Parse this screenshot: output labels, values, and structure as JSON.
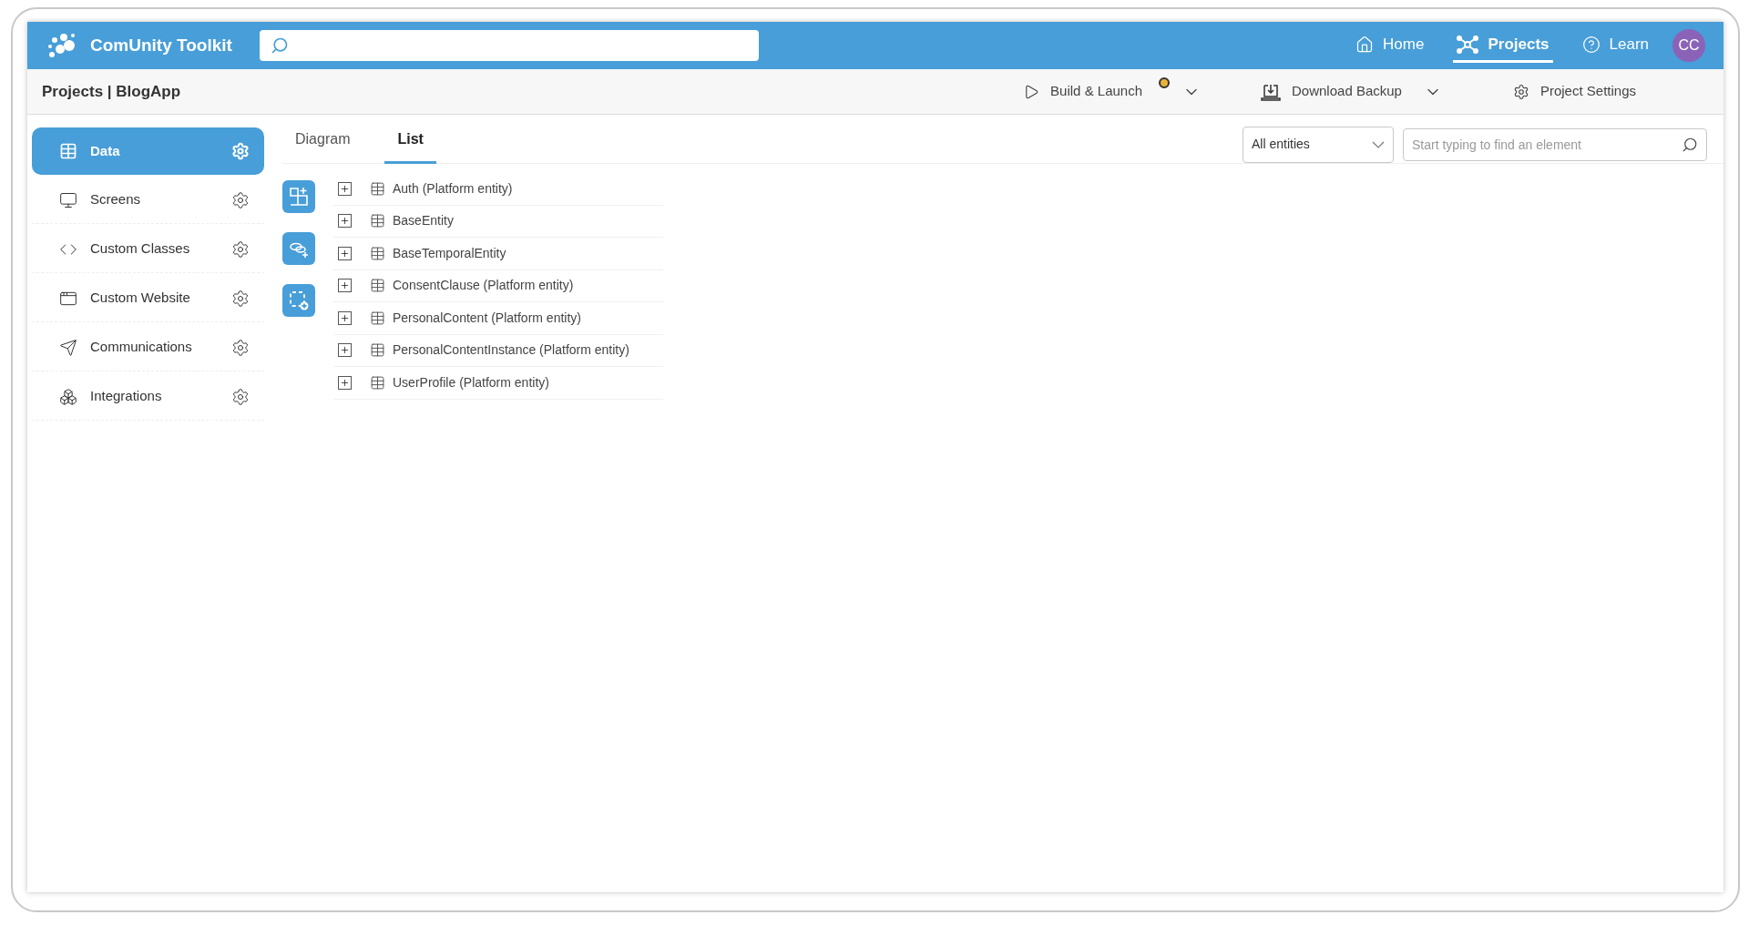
{
  "app": {
    "name": "ComUnity Toolkit"
  },
  "header_nav": [
    {
      "label": "Home",
      "selected": false
    },
    {
      "label": "Projects",
      "selected": true
    },
    {
      "label": "Learn",
      "selected": false
    }
  ],
  "avatar": {
    "initials": "CC"
  },
  "breadcrumb": "Projects | BlogApp",
  "toolbar": {
    "build": {
      "label": "Build & Launch",
      "indicator": true
    },
    "download": {
      "label": "Download Backup"
    },
    "settings": {
      "label": "Project Settings"
    }
  },
  "sidebar": {
    "items": [
      {
        "label": "Data",
        "selected": true
      },
      {
        "label": "Screens",
        "selected": false
      },
      {
        "label": "Custom Classes",
        "selected": false
      },
      {
        "label": "Custom Website",
        "selected": false
      },
      {
        "label": "Communications",
        "selected": false
      },
      {
        "label": "Integrations",
        "selected": false
      }
    ]
  },
  "tabs": [
    {
      "label": "Diagram",
      "selected": false
    },
    {
      "label": "List",
      "selected": true
    }
  ],
  "filter": {
    "value": "All entities"
  },
  "search": {
    "placeholder": "Start typing to find an element"
  },
  "entities": [
    {
      "name": "Auth (Platform entity)",
      "expanded": false
    },
    {
      "name": "BaseEntity",
      "expanded": false
    },
    {
      "name": "BaseTemporalEntity",
      "expanded": false
    },
    {
      "name": "ConsentClause (Platform entity)",
      "expanded": false
    },
    {
      "name": "PersonalContent (Platform entity)",
      "expanded": false
    },
    {
      "name": "PersonalContentInstance (Platform entity)",
      "expanded": false
    },
    {
      "name": "UserProfile (Platform entity)",
      "expanded": false
    }
  ]
}
